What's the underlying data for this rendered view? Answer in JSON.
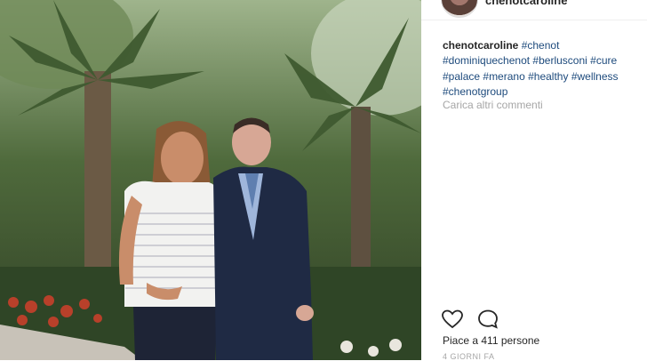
{
  "post": {
    "username": "chenotcaroline",
    "caption": {
      "user": "chenotcaroline",
      "tags": [
        "#chenot",
        "#dominiquechenot",
        "#berlusconi",
        "#cure",
        "#palace",
        "#merano",
        "#healthy",
        "#wellness",
        "#chenotgroup"
      ]
    },
    "load_more_comments": "Carica altri commenti",
    "likes_text": "Piace a 411 persone",
    "timestamp": "4 GIORNI FA"
  },
  "icons": {
    "like": "heart-outline-icon",
    "comment": "speech-bubble-icon"
  },
  "colors": {
    "hashtag": "#1d4a7c",
    "secondary_text": "#a6a6a6",
    "primary_text": "#262626"
  }
}
